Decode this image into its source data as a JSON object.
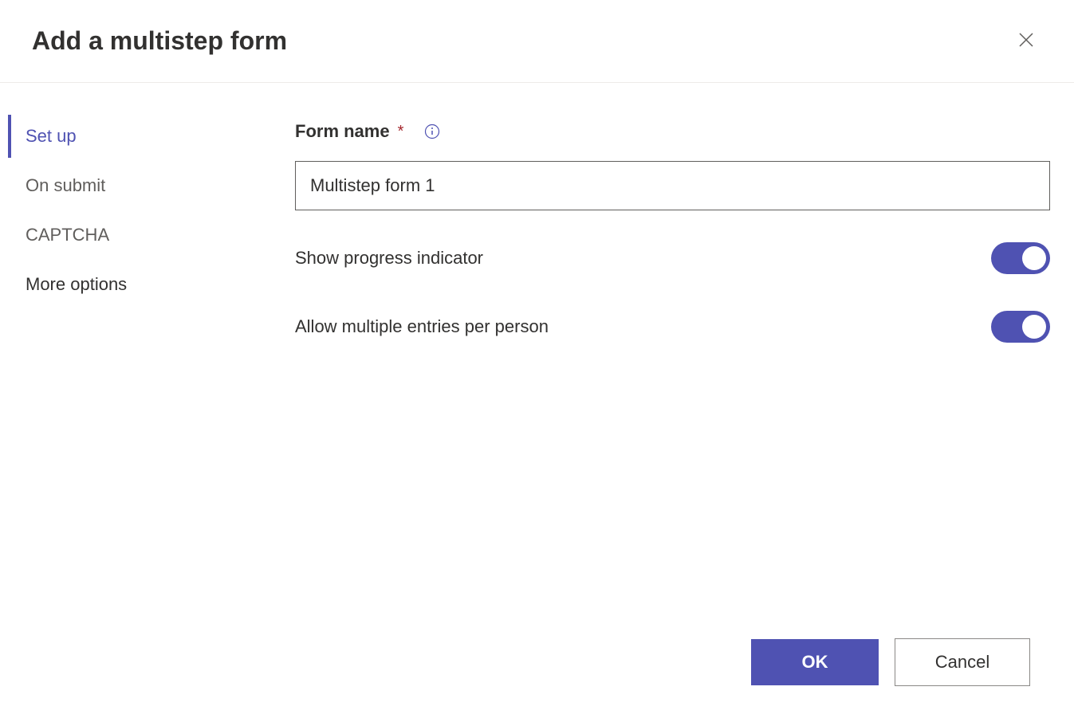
{
  "header": {
    "title": "Add a multistep form"
  },
  "sidebar": {
    "items": [
      {
        "label": "Set up",
        "active": true
      },
      {
        "label": "On submit",
        "active": false
      },
      {
        "label": "CAPTCHA",
        "active": false
      },
      {
        "label": "More options",
        "active": false
      }
    ]
  },
  "form": {
    "name_label": "Form name",
    "name_value": "Multistep form 1",
    "show_progress_label": "Show progress indicator",
    "show_progress_on": true,
    "allow_multiple_label": "Allow multiple entries per person",
    "allow_multiple_on": true
  },
  "footer": {
    "ok_label": "OK",
    "cancel_label": "Cancel"
  }
}
